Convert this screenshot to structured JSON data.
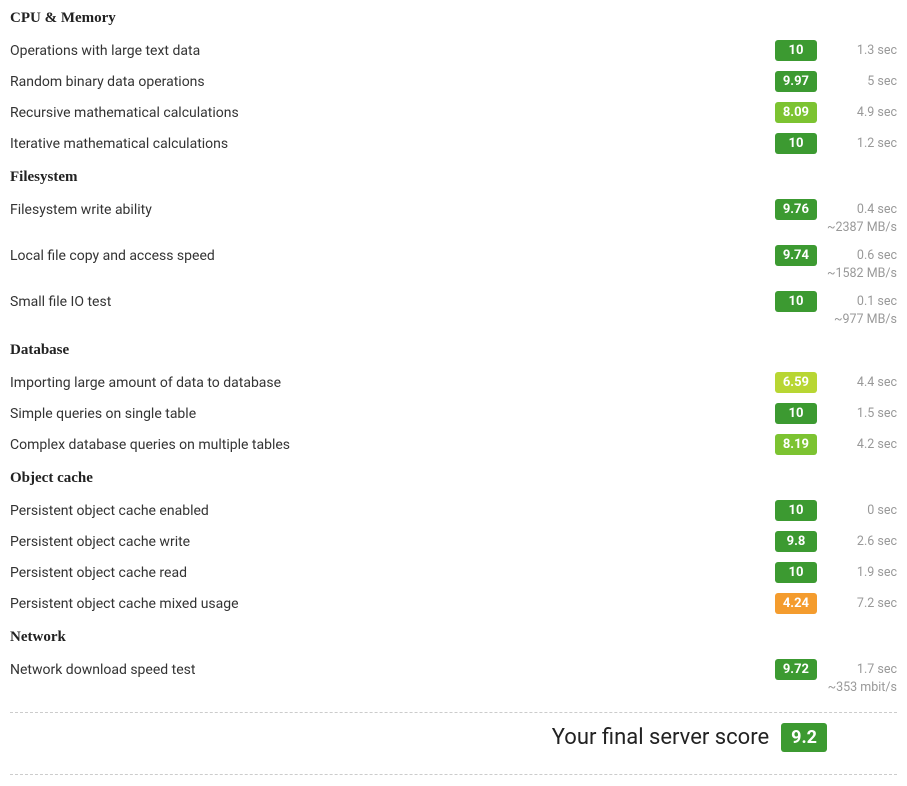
{
  "sections": [
    {
      "title": "CPU & Memory",
      "tests": [
        {
          "label": "Operations with large text data",
          "score": "10",
          "score_class": "score-green",
          "time": "1.3 sec",
          "sub": null
        },
        {
          "label": "Random binary data operations",
          "score": "9.97",
          "score_class": "score-green",
          "time": "5 sec",
          "sub": null
        },
        {
          "label": "Recursive mathematical calculations",
          "score": "8.09",
          "score_class": "score-lightgreen",
          "time": "4.9 sec",
          "sub": null
        },
        {
          "label": "Iterative mathematical calculations",
          "score": "10",
          "score_class": "score-green",
          "time": "1.2 sec",
          "sub": null
        }
      ]
    },
    {
      "title": "Filesystem",
      "tests": [
        {
          "label": "Filesystem write ability",
          "score": "9.76",
          "score_class": "score-green",
          "time": "0.4 sec",
          "sub": "~2387 MB/s"
        },
        {
          "label": "Local file copy and access speed",
          "score": "9.74",
          "score_class": "score-green",
          "time": "0.6 sec",
          "sub": "~1582 MB/s"
        },
        {
          "label": "Small file IO test",
          "score": "10",
          "score_class": "score-green",
          "time": "0.1 sec",
          "sub": "~977 MB/s"
        }
      ]
    },
    {
      "title": "Database",
      "tests": [
        {
          "label": "Importing large amount of data to database",
          "score": "6.59",
          "score_class": "score-yellowgreen",
          "time": "4.4 sec",
          "sub": null
        },
        {
          "label": "Simple queries on single table",
          "score": "10",
          "score_class": "score-green",
          "time": "1.5 sec",
          "sub": null
        },
        {
          "label": "Complex database queries on multiple tables",
          "score": "8.19",
          "score_class": "score-lightgreen",
          "time": "4.2 sec",
          "sub": null
        }
      ]
    },
    {
      "title": "Object cache",
      "tests": [
        {
          "label": "Persistent object cache enabled",
          "score": "10",
          "score_class": "score-green",
          "time": "0 sec",
          "sub": null
        },
        {
          "label": "Persistent object cache write",
          "score": "9.8",
          "score_class": "score-green",
          "time": "2.6 sec",
          "sub": null
        },
        {
          "label": "Persistent object cache read",
          "score": "10",
          "score_class": "score-green",
          "time": "1.9 sec",
          "sub": null
        },
        {
          "label": "Persistent object cache mixed usage",
          "score": "4.24",
          "score_class": "score-orange",
          "time": "7.2 sec",
          "sub": null
        }
      ]
    },
    {
      "title": "Network",
      "tests": [
        {
          "label": "Network download speed test",
          "score": "9.72",
          "score_class": "score-green",
          "time": "1.7 sec",
          "sub": "~353 mbit/s"
        }
      ]
    }
  ],
  "final": {
    "label": "Your final server score",
    "score": "9.2"
  }
}
